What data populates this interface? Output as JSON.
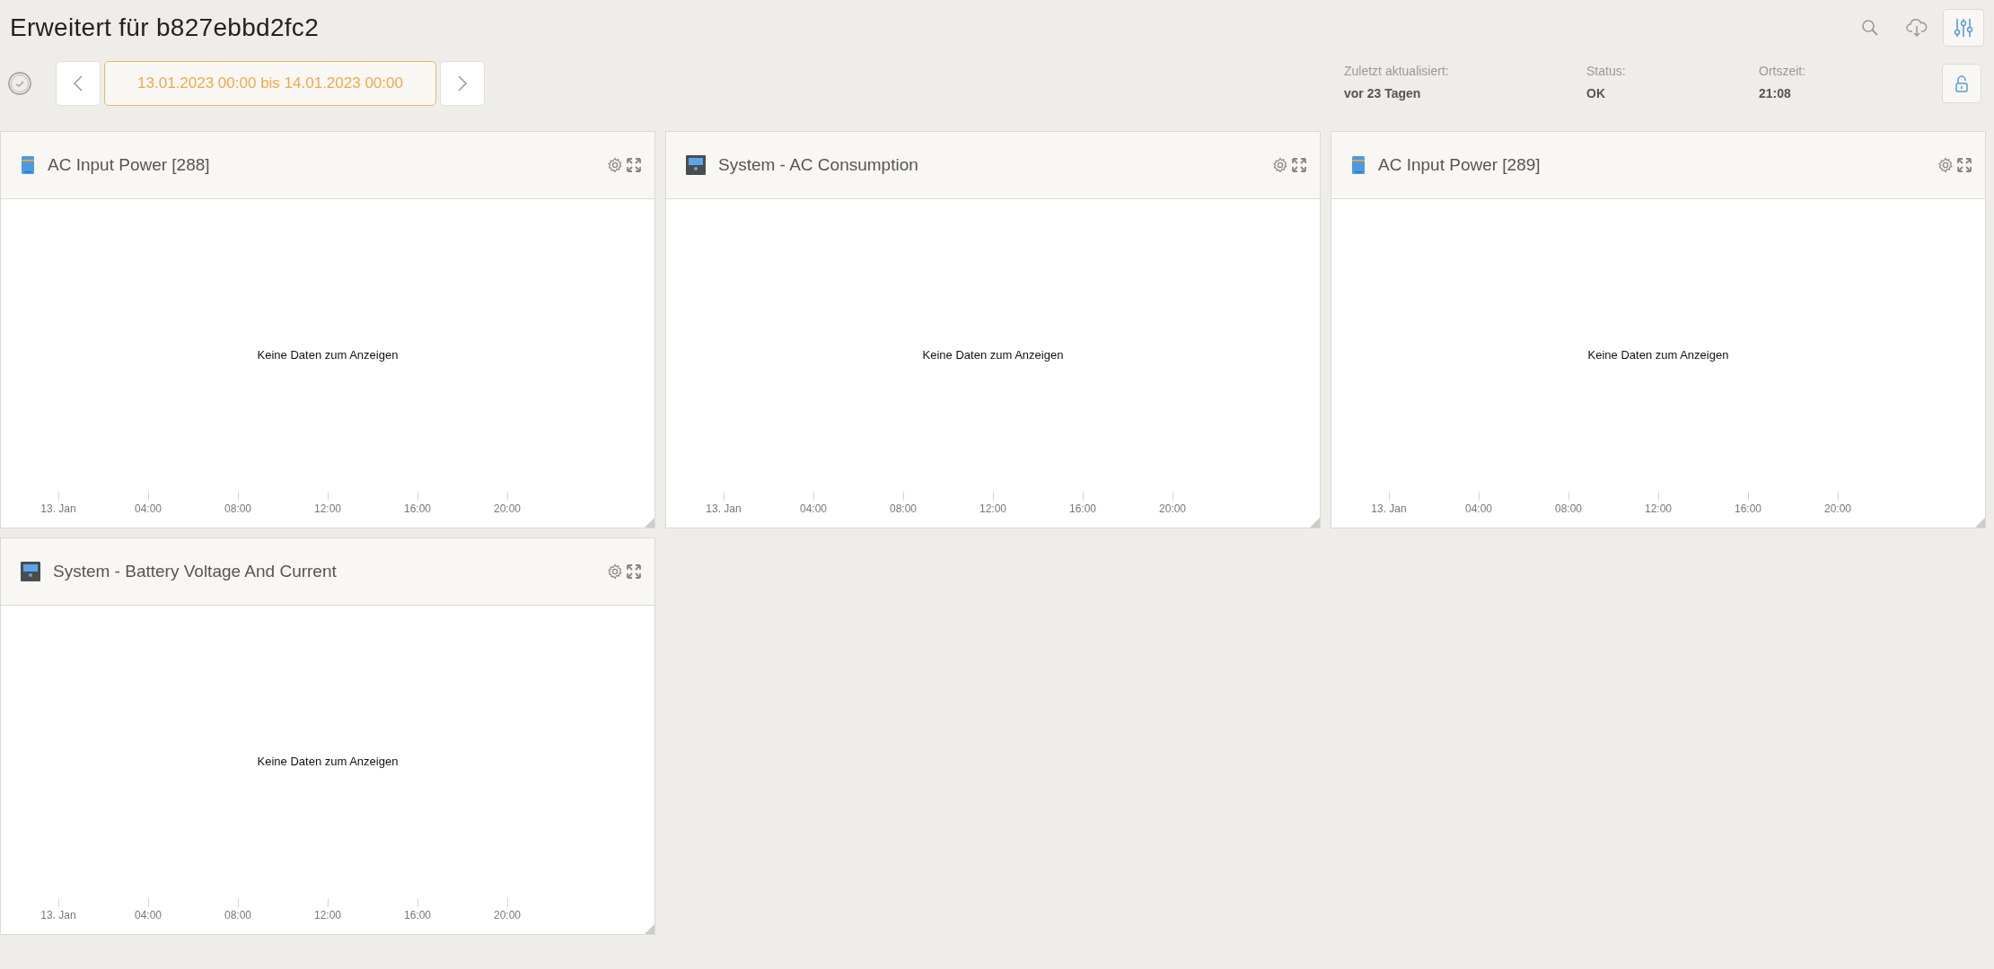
{
  "title": "Erweitert für b827ebbd2fc2",
  "toolbar_buttons": [
    {
      "kind": "search",
      "selected": false
    },
    {
      "kind": "download",
      "selected": false
    },
    {
      "kind": "filters",
      "selected": true
    }
  ],
  "date_range": "13.01.2023 00:00 bis 14.01.2023 00:00",
  "info": [
    {
      "label": "Zuletzt aktualisiert:",
      "value": "vor 23 Tagen"
    },
    {
      "label": "Status:",
      "value": "OK"
    },
    {
      "label": "Ortszeit:",
      "value": "21:08"
    }
  ],
  "lock": {
    "locked": false
  },
  "panels": [
    {
      "kind": "inverter",
      "title": "AC Input Power [288]",
      "message": "Keine Daten zum Anzeigen",
      "x_ticks": [
        "13. Jan",
        "04:00",
        "08:00",
        "12:00",
        "16:00",
        "20:00"
      ]
    },
    {
      "kind": "system",
      "title": "System - AC Consumption",
      "message": "Keine Daten zum Anzeigen",
      "x_ticks": [
        "13. Jan",
        "04:00",
        "08:00",
        "12:00",
        "16:00",
        "20:00"
      ]
    },
    {
      "kind": "inverter",
      "title": "AC Input Power [289]",
      "message": "Keine Daten zum Anzeigen",
      "x_ticks": [
        "13. Jan",
        "04:00",
        "08:00",
        "12:00",
        "16:00",
        "20:00"
      ]
    },
    {
      "kind": "system",
      "title": "System - Battery Voltage And Current",
      "message": "Keine Daten zum Anzeigen",
      "x_ticks": [
        "13. Jan",
        "04:00",
        "08:00",
        "12:00",
        "16:00",
        "20:00"
      ]
    }
  ]
}
